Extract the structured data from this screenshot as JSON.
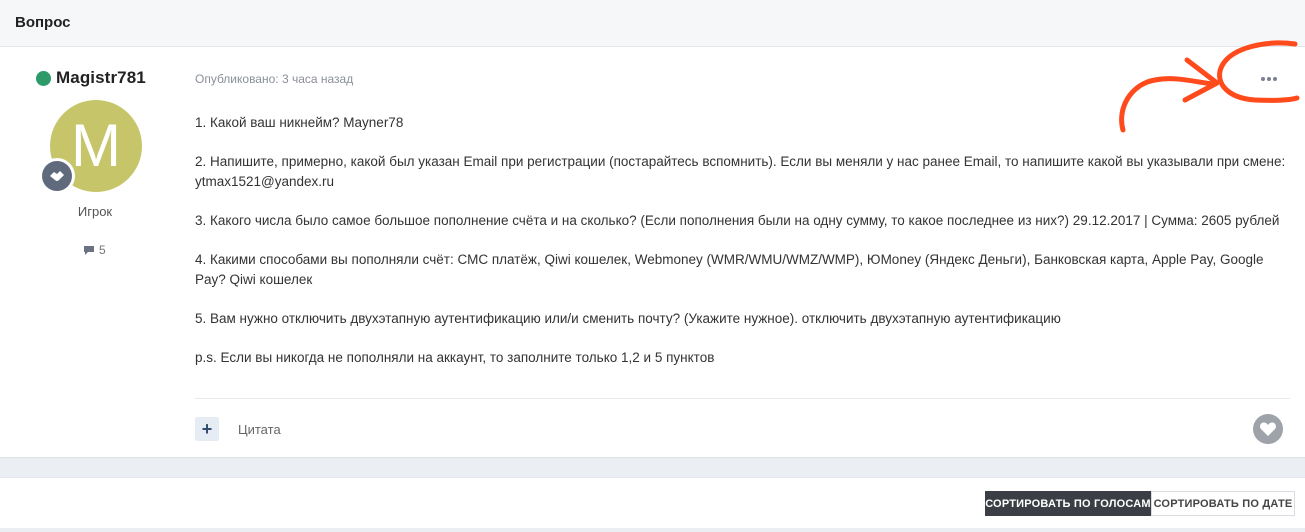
{
  "header": {
    "title": "Вопрос"
  },
  "author": {
    "name": "Magistr781",
    "avatar_letter": "M",
    "avatar_color": "#c7c56a",
    "online_color": "#2e9a6a",
    "rank": "Игрок",
    "post_count": "5"
  },
  "post": {
    "meta": "Опубликовано: 3 часа назад",
    "paragraphs": [
      "1. Какой ваш никнейм? Mayner78",
      "2. Напишите, примерно, какой был указан Email при регистрации (постарайтесь вспомнить). Если вы меняли у нас ранее Email, то напишите какой вы указывали при смене: ytmax1521@yandex.ru",
      "3. Какого числа было самое большое пополнение счёта и на сколько? (Если пополнения были на одну сумму, то какое последнее из них?) 29.12.2017 | Сумма: 2605 рублей",
      "4. Какими способами вы пополняли счёт: СМС платёж, Qiwi кошелек, Webmoney (WMR/WMU/WMZ/WMP), ЮMoney (Яндекс Деньги), Банковская карта, Apple Pay, Google Pay? Qiwi кошелек",
      "5. Вам нужно отключить двухэтапную аутентификацию или/и сменить почту? (Укажите нужное). отключить двухэтапную аутентификацию",
      "p.s. Если вы никогда не пополняли на аккаунт, то заполните только 1,2 и 5 пунктов"
    ],
    "quote_plus": "+",
    "quote_label": "Цитата"
  },
  "sort": {
    "by_votes": "СОРТИРОВАТЬ ПО ГОЛОСАМ",
    "by_date": "СОРТИРОВАТЬ ПО ДАТЕ"
  },
  "icons": {
    "more": "ellipsis-icon",
    "like": "heart-icon",
    "comment": "speech-bubble-icon",
    "rank": "handshake-icon"
  },
  "annotation_color": "#ff4a1c"
}
